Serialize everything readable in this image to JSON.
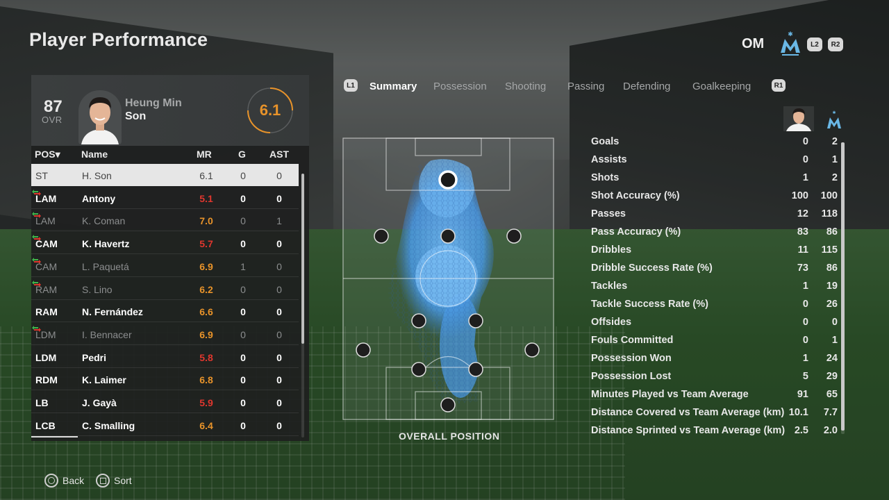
{
  "title": "Player Performance",
  "team": {
    "code": "OM",
    "l2": "L2",
    "r2": "R2"
  },
  "player": {
    "ovr": "87",
    "ovr_label": "OVR",
    "first_name": "Heung Min",
    "last_name": "Son",
    "rating": "6.1"
  },
  "table": {
    "headers": {
      "pos": "POS",
      "name": "Name",
      "mr": "MR",
      "g": "G",
      "ast": "AST"
    },
    "rows": [
      {
        "pos": "ST",
        "name": "H. Son",
        "mr": "6.1",
        "g": "0",
        "ast": "0",
        "trend": false,
        "state": "selected",
        "mr_color": "normal"
      },
      {
        "pos": "LAM",
        "name": "Antony",
        "mr": "5.1",
        "g": "0",
        "ast": "0",
        "trend": true,
        "state": "normal",
        "mr_color": "red"
      },
      {
        "pos": "LAM",
        "name": "K. Coman",
        "mr": "7.0",
        "g": "0",
        "ast": "1",
        "trend": true,
        "state": "dim",
        "mr_color": "orange"
      },
      {
        "pos": "CAM",
        "name": "K. Havertz",
        "mr": "5.7",
        "g": "0",
        "ast": "0",
        "trend": true,
        "state": "normal",
        "mr_color": "red"
      },
      {
        "pos": "CAM",
        "name": "L. Paquetá",
        "mr": "6.9",
        "g": "1",
        "ast": "0",
        "trend": true,
        "state": "dim",
        "mr_color": "orange"
      },
      {
        "pos": "RAM",
        "name": "S. Lino",
        "mr": "6.2",
        "g": "0",
        "ast": "0",
        "trend": true,
        "state": "dim",
        "mr_color": "orange"
      },
      {
        "pos": "RAM",
        "name": "N. Fernández",
        "mr": "6.6",
        "g": "0",
        "ast": "0",
        "trend": false,
        "state": "normal",
        "mr_color": "orange"
      },
      {
        "pos": "LDM",
        "name": "I. Bennacer",
        "mr": "6.9",
        "g": "0",
        "ast": "0",
        "trend": true,
        "state": "dim",
        "mr_color": "orange"
      },
      {
        "pos": "LDM",
        "name": "Pedri",
        "mr": "5.8",
        "g": "0",
        "ast": "0",
        "trend": false,
        "state": "normal",
        "mr_color": "red"
      },
      {
        "pos": "RDM",
        "name": "K. Laimer",
        "mr": "6.8",
        "g": "0",
        "ast": "0",
        "trend": false,
        "state": "normal",
        "mr_color": "orange"
      },
      {
        "pos": "LB",
        "name": "J. Gayà",
        "mr": "5.9",
        "g": "0",
        "ast": "0",
        "trend": false,
        "state": "normal",
        "mr_color": "red"
      },
      {
        "pos": "LCB",
        "name": "C. Smalling",
        "mr": "6.4",
        "g": "0",
        "ast": "0",
        "trend": false,
        "state": "normal",
        "mr_color": "orange"
      }
    ]
  },
  "tabs": {
    "l1": "L1",
    "r1": "R1",
    "items": [
      "Summary",
      "Possession",
      "Shooting",
      "Passing",
      "Defending",
      "Goalkeeping"
    ],
    "active": 0
  },
  "pitch": {
    "caption": "OVERALL POSITION"
  },
  "stats": [
    {
      "label": "Goals",
      "player": "0",
      "team": "2"
    },
    {
      "label": "Assists",
      "player": "0",
      "team": "1"
    },
    {
      "label": "Shots",
      "player": "1",
      "team": "2"
    },
    {
      "label": "Shot Accuracy (%)",
      "player": "100",
      "team": "100"
    },
    {
      "label": "Passes",
      "player": "12",
      "team": "118"
    },
    {
      "label": "Pass Accuracy (%)",
      "player": "83",
      "team": "86"
    },
    {
      "label": "Dribbles",
      "player": "11",
      "team": "115"
    },
    {
      "label": "Dribble Success Rate (%)",
      "player": "73",
      "team": "86"
    },
    {
      "label": "Tackles",
      "player": "1",
      "team": "19"
    },
    {
      "label": "Tackle Success Rate (%)",
      "player": "0",
      "team": "26"
    },
    {
      "label": "Offsides",
      "player": "0",
      "team": "0"
    },
    {
      "label": "Fouls Committed",
      "player": "0",
      "team": "1"
    },
    {
      "label": "Possession Won",
      "player": "1",
      "team": "24"
    },
    {
      "label": "Possession Lost",
      "player": "5",
      "team": "29"
    },
    {
      "label": "Minutes Played vs Team Average",
      "player": "91",
      "team": "65"
    },
    {
      "label": "Distance Covered vs Team Average (km)",
      "player": "10.1",
      "team": "7.7"
    },
    {
      "label": "Distance Sprinted vs Team Average (km)",
      "player": "2.5",
      "team": "2.0"
    }
  ],
  "hints": {
    "back": "Back",
    "sort": "Sort"
  },
  "colors": {
    "rating_orange": "#e8932a",
    "rating_red": "#e0372e",
    "heat_blue": "#5aa9ec"
  }
}
